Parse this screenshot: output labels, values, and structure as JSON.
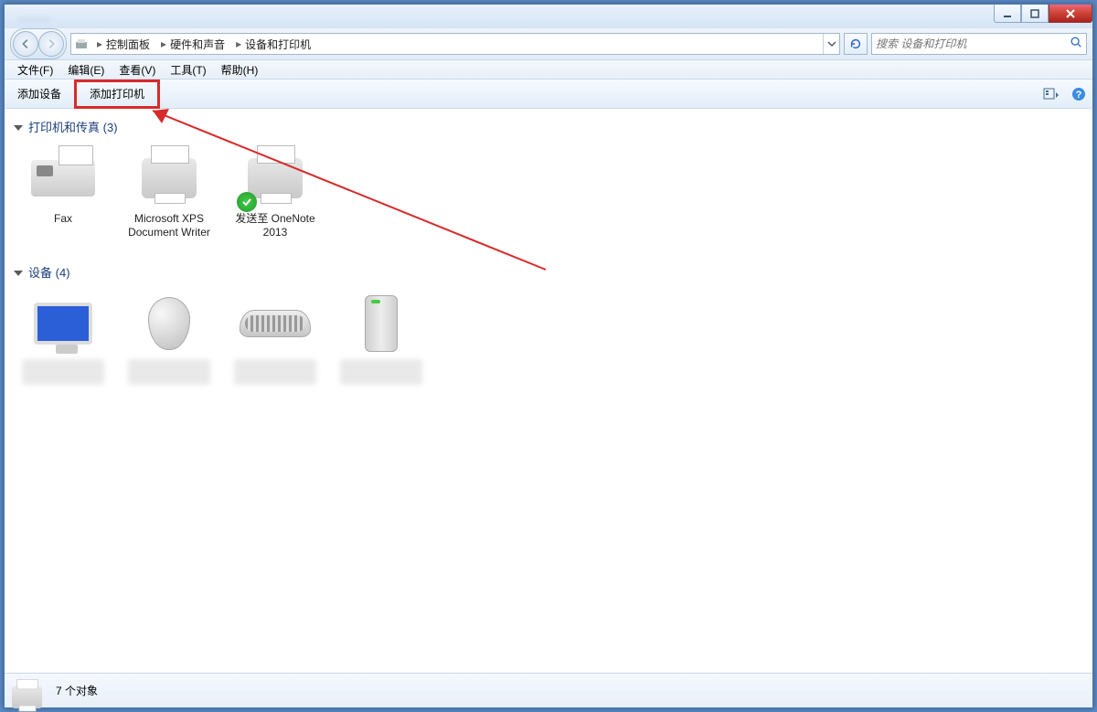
{
  "window": {
    "title_blurred": "………"
  },
  "breadcrumb": {
    "seg1": "控制面板",
    "seg2": "硬件和声音",
    "seg3": "设备和打印机"
  },
  "search": {
    "placeholder": "搜索 设备和打印机"
  },
  "menu": {
    "file": "文件(F)",
    "edit": "编辑(E)",
    "view": "查看(V)",
    "tools": "工具(T)",
    "help": "帮助(H)"
  },
  "toolbar": {
    "add_device": "添加设备",
    "add_printer": "添加打印机"
  },
  "groups": {
    "printers": {
      "title": "打印机和传真",
      "count": "(3)"
    },
    "devices": {
      "title": "设备",
      "count": "(4)"
    }
  },
  "printer_items": [
    {
      "label": "Fax"
    },
    {
      "label": "Microsoft XPS Document Writer"
    },
    {
      "label": "发送至 OneNote 2013",
      "default": true
    }
  ],
  "device_items": [
    {
      "kind": "monitor"
    },
    {
      "kind": "mouse"
    },
    {
      "kind": "keyboard"
    },
    {
      "kind": "tower"
    }
  ],
  "status": {
    "text": "7 个对象"
  }
}
